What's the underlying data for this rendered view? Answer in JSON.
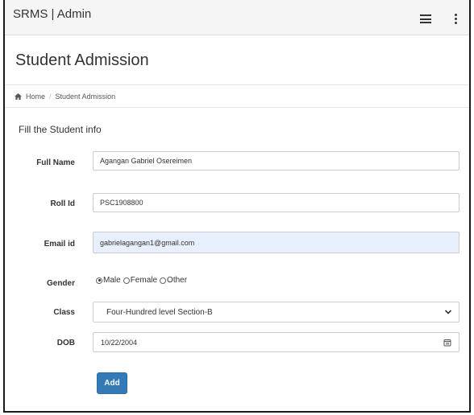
{
  "topbar": {
    "brand": "SRMS | Admin",
    "menu_icon": "hamburger-icon",
    "more_icon": "kebab-icon"
  },
  "page": {
    "title": "Student Admission"
  },
  "breadcrumb": {
    "home_icon": "home-icon",
    "home": "Home",
    "separator": "/",
    "current": "Student Admission"
  },
  "form": {
    "section_title": "Fill the Student info",
    "full_name": {
      "label": "Full Name",
      "value": "Agangan Gabriel Osereimen"
    },
    "roll_id": {
      "label": "Roll Id",
      "value": "PSC1908800"
    },
    "email": {
      "label": "Email id",
      "value": "gabrielagangan1@gmail.com"
    },
    "gender": {
      "label": "Gender",
      "options": [
        "Male",
        "Female",
        "Other"
      ],
      "selected": "Male"
    },
    "class": {
      "label": "Class",
      "selected": "Four-Hundred level  Section-B"
    },
    "dob": {
      "label": "DOB",
      "value": "10/22/2004",
      "icon": "calendar-icon"
    },
    "submit_label": "Add"
  },
  "colors": {
    "primary": "#337ab7",
    "autofill": "#e8f0fe",
    "topbar_bg": "#f5f5f5"
  }
}
